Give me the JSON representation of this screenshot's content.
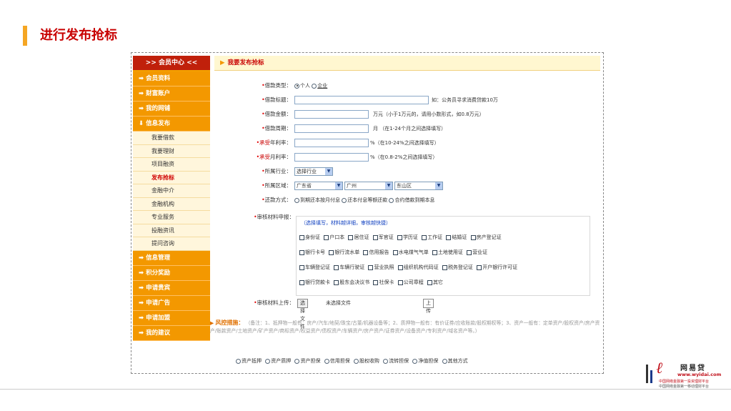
{
  "slide": {
    "title": "进行发布抢标"
  },
  "sidebar": {
    "header": ">> 会员中心 <<",
    "items_top": [
      {
        "label": "➡ 会员资料"
      },
      {
        "label": "➡ 财富账户"
      },
      {
        "label": "➡ 我的网铺"
      },
      {
        "label": "⬇ 信息发布"
      }
    ],
    "subitems": [
      {
        "label": "我要借款"
      },
      {
        "label": "我要理财"
      },
      {
        "label": "项目融资"
      },
      {
        "label": "发布抢标"
      },
      {
        "label": "金融中介"
      },
      {
        "label": "金融机构"
      },
      {
        "label": "专业服务"
      },
      {
        "label": "投融资讯"
      },
      {
        "label": "提问咨询"
      }
    ],
    "items_bottom": [
      {
        "label": "➡ 信息管理"
      },
      {
        "label": "➡ 积分奖励"
      },
      {
        "label": "➡ 申请贵宾"
      },
      {
        "label": "➡ 申请广告"
      },
      {
        "label": "➡ 申请加盟"
      },
      {
        "label": "➡ 我的建议"
      }
    ]
  },
  "main": {
    "header": "我要发布抢标",
    "loan_type": {
      "label": "借款类型：",
      "options": [
        "个人",
        "企业"
      ]
    },
    "loan_title": {
      "label": "借款标题：",
      "hint": "如：公务员寻求消费贷款10万"
    },
    "loan_amount": {
      "label": "借款金额：",
      "hint": "万元（小于1万元的，请用小数形式，如0.8万元）"
    },
    "loan_period": {
      "label": "借款周期：",
      "hint": "月 （在1-24个月之间选择填写）"
    },
    "annual_rate": {
      "label": "年利率：",
      "label_prefix": "承受",
      "hint": "%（在10-24%之间选择填写）"
    },
    "monthly_rate": {
      "label": "月利率：",
      "label_prefix": "承受",
      "hint": "%（在0.8-2%之间选择填写）"
    },
    "industry": {
      "label": "所属行业：",
      "value": "选择行业"
    },
    "region": {
      "label": "所属区域：",
      "province": "广东省",
      "city": "广州",
      "district": "东山区"
    },
    "repay": {
      "label": "还款方式：",
      "options": [
        "到期还本按月付息",
        "还本付息等额还款",
        "合约借款到期本息"
      ]
    },
    "materials": {
      "label": "审核材料申报：",
      "tip": "（选择填写，材料越详细，审核越快捷）",
      "line1": [
        "身份证",
        "户口本",
        "居住证",
        "军官证",
        "学历证",
        "工作证",
        "结婚证",
        "房产登记证"
      ],
      "line2": [
        "银行卡号",
        "银行流水单",
        "信用报告",
        "水电煤气气单",
        "土地使用证",
        "营业证"
      ],
      "line3": [
        "车辆登记证",
        "车辆行驶证",
        "营业执照",
        "组织机构代码证",
        "税务登记证",
        "开户银行许可证"
      ],
      "line4": [
        "银行贷款卡",
        "股东会决议书",
        "社保卡",
        "公司章程",
        "其它"
      ]
    },
    "upload": {
      "label": "审核材料上传：",
      "choose": "选择文件",
      "status": "未选择文件",
      "button": "上传"
    },
    "risk": {
      "title": "风控措施：",
      "text": "（备注：1、抵押物一般有：房产/汽车/地契/珠宝/古董/机器设备等；2、质押物一般有：有价证券/应收账款/股权期权等；3、资产一般有：定单资产/股权资产/房产资产/账款资产/土地资产/矿产资产/商标资产/权益资产/债权资产/车辆资产/房产资产/证券资产/设备资产/专利资产/域名资产等。）"
    },
    "guarantee": [
      "资产抵押",
      "资产质押",
      "资产担保",
      "信用担保",
      "股权收购",
      "流转担保",
      "净值担保",
      "其他方式"
    ]
  },
  "logo": {
    "name": "网易贷",
    "url": "www.wyidai.com",
    "tagline1": "中国网络金融第一投资理财平台",
    "tagline2": "中国网络金融第一移动理财平台"
  }
}
